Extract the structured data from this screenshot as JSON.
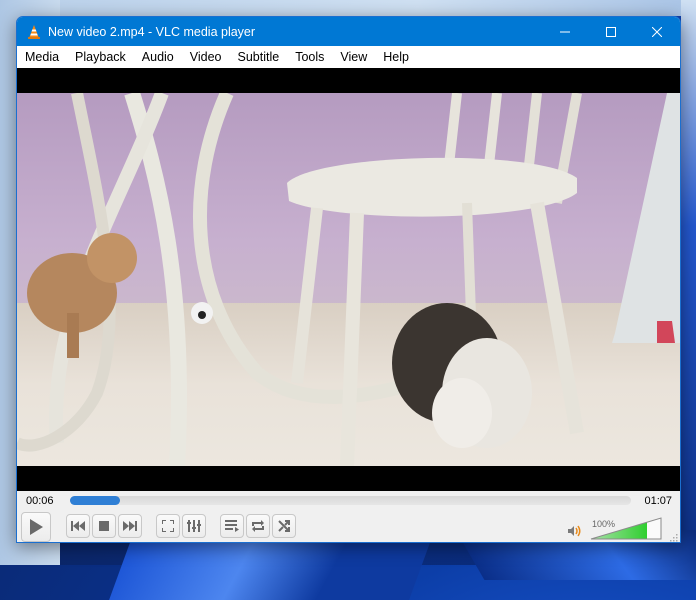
{
  "window": {
    "title": "New video 2.mp4 - VLC media player",
    "controls": {
      "minimize": "minimize-icon",
      "maximize": "maximize-icon",
      "close": "close-icon"
    }
  },
  "menu": {
    "items": [
      {
        "label": "Media"
      },
      {
        "label": "Playback"
      },
      {
        "label": "Audio"
      },
      {
        "label": "Video"
      },
      {
        "label": "Subtitle"
      },
      {
        "label": "Tools"
      },
      {
        "label": "View"
      },
      {
        "label": "Help"
      }
    ]
  },
  "player": {
    "time_elapsed": "00:06",
    "time_total": "01:07",
    "progress_fraction": 0.09,
    "volume_label": "100%",
    "volume_fraction": 0.8,
    "buttons": [
      {
        "name": "play-button",
        "icon": "play-icon"
      },
      {
        "name": "previous-button",
        "icon": "skip-previous-icon"
      },
      {
        "name": "stop-button",
        "icon": "stop-icon"
      },
      {
        "name": "next-button",
        "icon": "skip-next-icon"
      },
      {
        "name": "fullscreen-button",
        "icon": "fullscreen-icon"
      },
      {
        "name": "extended-settings-button",
        "icon": "equalizer-icon"
      },
      {
        "name": "playlist-button",
        "icon": "playlist-icon"
      },
      {
        "name": "loop-button",
        "icon": "loop-icon"
      },
      {
        "name": "shuffle-button",
        "icon": "shuffle-icon"
      }
    ]
  },
  "colors": {
    "titlebar": "#0078d4",
    "seek_fill": "#2f7fd5",
    "volume_fill": "#3dc43d",
    "speaker": "#e88a1a"
  }
}
